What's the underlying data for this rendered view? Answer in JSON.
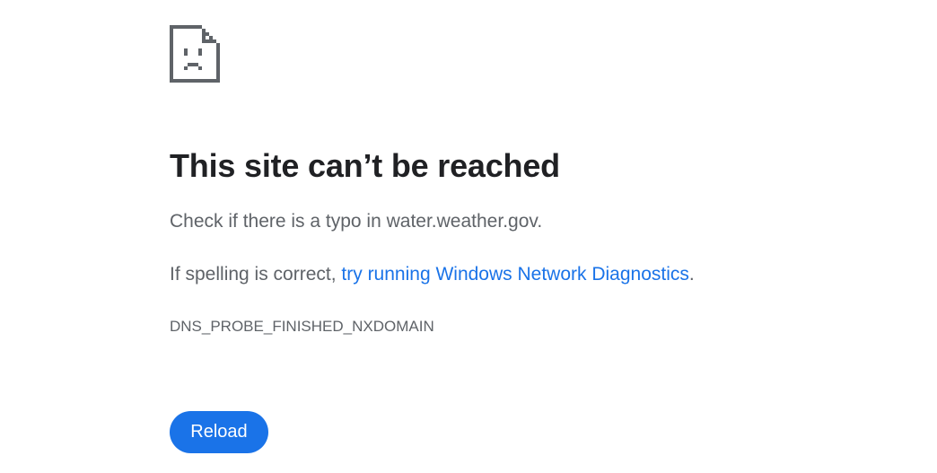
{
  "error": {
    "icon": "sad-page-icon",
    "heading": "This site can’t be reached",
    "message_1": "Check if there is a typo in water.weather.gov.",
    "message_2_prefix": "If spelling is correct, ",
    "diagnostics_link": "try running Windows Network Diagnostics",
    "message_2_suffix": ".",
    "code": "DNS_PROBE_FINISHED_NXDOMAIN"
  },
  "buttons": {
    "reload_label": "Reload"
  },
  "colors": {
    "link": "#1a73e8",
    "button_bg": "#1a73e8",
    "heading": "#202124",
    "body_text": "#5f6368",
    "icon": "#5f6368"
  }
}
